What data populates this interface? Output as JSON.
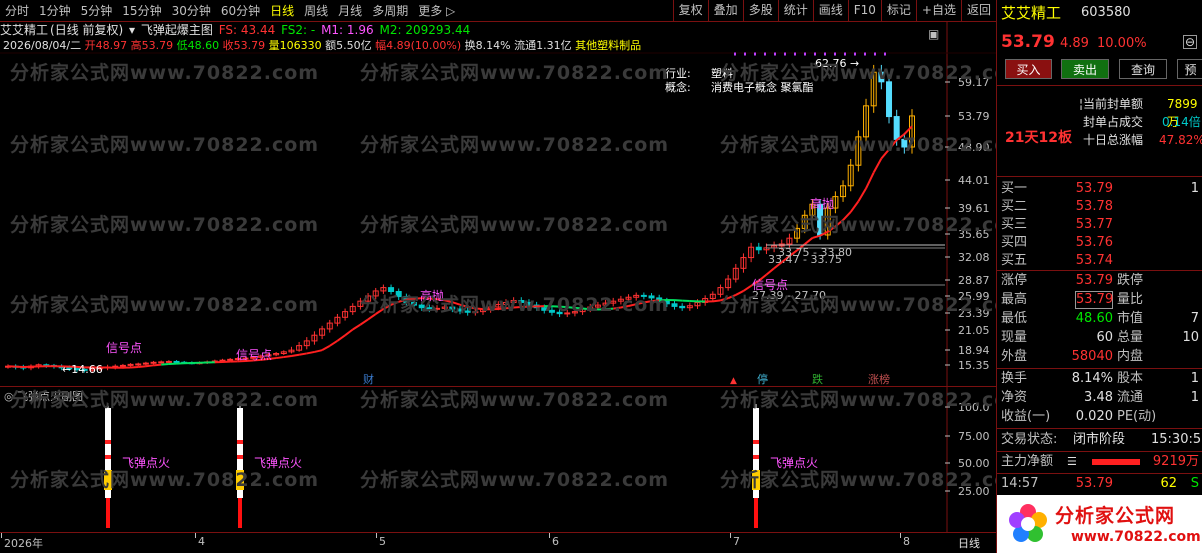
{
  "toolbar": {
    "periods": [
      "分时",
      "1分钟",
      "5分钟",
      "15分钟",
      "30分钟",
      "60分钟",
      "日线",
      "周线",
      "月线",
      "多周期",
      "更多 ▷"
    ],
    "active_period": "日线",
    "buttons": [
      "复权",
      "叠加",
      "多股",
      "统计",
      "画线",
      "F10",
      "标记",
      "+自选",
      "返回"
    ]
  },
  "chart_header": {
    "stock_name": "艾艾精工",
    "mode": "(日线 前复权)",
    "indicator_name": "飞弹起爆主图",
    "fs": "FS: 43.44",
    "fs2": "FS2: -",
    "m1": "M1: 1.96",
    "m2": "M2: 209293.44"
  },
  "info_line": {
    "date": "2026/08/04/二",
    "open": "开48.97",
    "high": "高53.79",
    "low": "低48.60",
    "close": "收53.79",
    "volume": "量106330",
    "amount": "额5.50亿",
    "change": "幅4.89(10.00%)",
    "turnover": "换8.14%",
    "float": "流通1.31亿",
    "concept": "其他塑料制品"
  },
  "popup": {
    "industry_label": "行业:",
    "industry_value": "塑料",
    "concept_label": "概念:",
    "concept_value": "消费电子概念 聚氯酯"
  },
  "chart_data": {
    "type": "candlestick",
    "y_ticks": [
      "59.17",
      "53.79",
      "48.90",
      "44.01",
      "39.61",
      "35.65",
      "32.08",
      "28.87",
      "25.99",
      "23.39",
      "21.05",
      "18.94",
      "15.35"
    ],
    "low_label": "←14.66",
    "high_label": "62.76",
    "range_labels": [
      "27.39 - 27.70",
      "33.75 - 33.80",
      "33.47 - 33.75"
    ],
    "signal_labels": [
      "信号点",
      "信号点",
      "信号点",
      "信号点"
    ],
    "high_throw_labels": [
      "高抛",
      "高抛"
    ],
    "event_tags": [
      "财",
      "停",
      "跌",
      "涨榜"
    ]
  },
  "sub_chart": {
    "title": "飞弹点火副图",
    "y_ticks": [
      "100.0",
      "75.00",
      "50.00",
      "25.00"
    ],
    "signal_label": "飞弹点火"
  },
  "x_axis": {
    "labels": [
      "2026年",
      "4",
      "5",
      "6",
      "7",
      "8"
    ],
    "period_label": "日线"
  },
  "watermark": "分析家公式网www.70822.com",
  "sidebar": {
    "name": "艾艾精工",
    "code": "603580",
    "price": "53.79",
    "change": "4.89",
    "pct": "10.00%",
    "buy_btn": "买入",
    "sell_btn": "卖出",
    "query_btn": "查询",
    "extra_btn": "预",
    "seal_label": "当前封单额",
    "seal_value": "7899万",
    "seal_ratio_label": "封单占成交",
    "seal_ratio_value": "0.14倍",
    "streak": "21天12板",
    "ten_day_label": "十日总涨幅",
    "ten_day_value": "47.82%",
    "bids": [
      {
        "label": "买一",
        "price": "53.79",
        "vol": "1"
      },
      {
        "label": "买二",
        "price": "53.78",
        "vol": ""
      },
      {
        "label": "买三",
        "price": "53.77",
        "vol": ""
      },
      {
        "label": "买四",
        "price": "53.76",
        "vol": ""
      },
      {
        "label": "买五",
        "price": "53.74",
        "vol": ""
      }
    ],
    "limit_up_label": "涨停",
    "limit_up": "53.79",
    "limit_down_label": "跌停",
    "high_label": "最高",
    "high": "53.79",
    "ratio_label": "量比",
    "low_label": "最低",
    "low": "48.60",
    "mcap_label": "市值",
    "mcap": "7",
    "cur_vol_label": "现量",
    "cur_vol": "60",
    "total_vol_label": "总量",
    "total_vol": "10",
    "outer_label": "外盘",
    "outer": "58040",
    "inner_label": "内盘",
    "turnover_label": "换手",
    "turnover": "8.14%",
    "equity_label": "股本",
    "equity": "1",
    "nav_label": "净资",
    "nav": "3.48",
    "float_label": "流通",
    "float": "1",
    "eps_label": "收益(一)",
    "eps": "0.020",
    "pe_label": "PE(动)",
    "state_label": "交易状态:",
    "state": "闭市阶段",
    "state_time": "15:30:53",
    "main_flow_label": "主力净额",
    "main_flow": "9219万",
    "tick_time": "14:57",
    "tick_price": "53.79",
    "tick_vol": "62",
    "tick_side": "S",
    "logo_text": "分析家公式网",
    "logo_url": "www.70822.com"
  }
}
